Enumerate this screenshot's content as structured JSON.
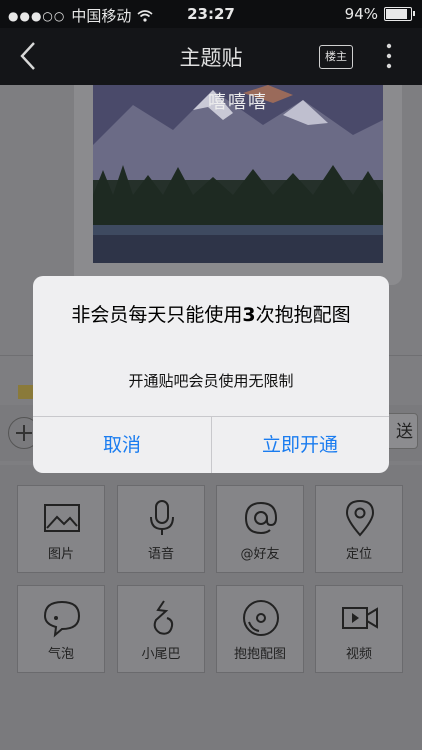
{
  "status_bar": {
    "carrier": "中国移动",
    "time": "23:27",
    "battery": "94%",
    "battery_level": 0.94
  },
  "nav": {
    "title": "主题贴",
    "owner_label": "楼主"
  },
  "post": {
    "image_caption": "嘻嘻嘻"
  },
  "composer": {
    "send_label": "送"
  },
  "tools": [
    {
      "label": "图片",
      "icon": "image-icon"
    },
    {
      "label": "语音",
      "icon": "microphone-icon"
    },
    {
      "label": "@好友",
      "icon": "at-icon"
    },
    {
      "label": "定位",
      "icon": "location-pin-icon"
    },
    {
      "label": "气泡",
      "icon": "speech-bubble-icon"
    },
    {
      "label": "小尾巴",
      "icon": "tail-icon"
    },
    {
      "label": "抱抱配图",
      "icon": "disc-icon"
    },
    {
      "label": "视频",
      "icon": "video-camera-icon"
    }
  ],
  "dialog": {
    "title": "非会员每天只能使用3次抱抱配图",
    "message": "开通贴吧会员使用无限制",
    "cancel_label": "取消",
    "confirm_label": "立即开通"
  },
  "colors": {
    "accent": "#1a7cf0",
    "dim_background": "#7e7e81",
    "dialog_bg": "#efeff1"
  }
}
